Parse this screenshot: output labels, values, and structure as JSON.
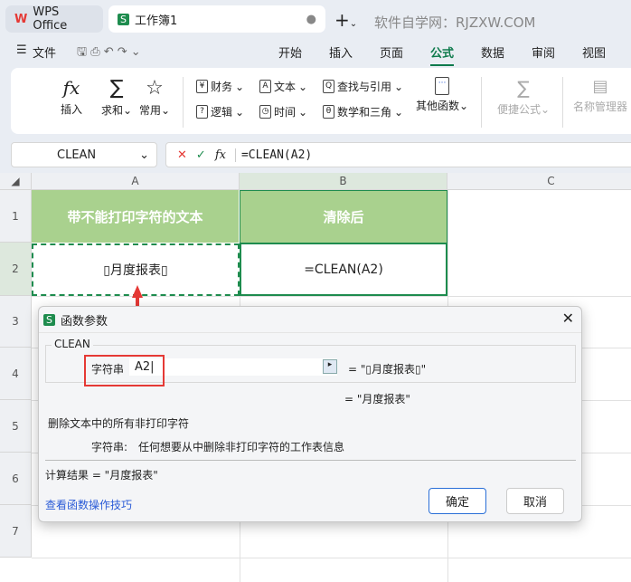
{
  "tabs": {
    "home": "WPS Office",
    "doc": "工作簿1",
    "watermark": "软件自学网：RJZXW.COM"
  },
  "menu": {
    "file": "文件",
    "items": [
      "开始",
      "插入",
      "页面",
      "公式",
      "数据",
      "审阅",
      "视图"
    ],
    "active": "公式",
    "accent": "#0e7a4c"
  },
  "ribbon": {
    "insert": "插入",
    "sum": "求和",
    "common": "常用",
    "finance": "财务",
    "text": "文本",
    "lookup": "查找与引用",
    "logic": "逻辑",
    "time": "时间",
    "math": "数学和三角",
    "other": "其他函数",
    "quick": "便捷公式",
    "names": "名称管理器"
  },
  "formula_bar": {
    "name_box": "CLEAN",
    "formula": "=CLEAN(A2)"
  },
  "columns": [
    "A",
    "B",
    "C"
  ],
  "rows": [
    "1",
    "2",
    "3",
    "4",
    "5",
    "6",
    "7"
  ],
  "cells": {
    "A1": "带不能打印字符的文本",
    "B1": "清除后",
    "A2": "▯月度报表▯",
    "B2": "=CLEAN(A2)"
  },
  "colors": {
    "header_fill": "#a9d18e",
    "header_text": "#ffffff",
    "selection": "#1e8c4e",
    "annotation": "#e53935"
  },
  "dialog": {
    "title": "函数参数",
    "function": "CLEAN",
    "arg_label": "字符串",
    "arg_value": "A2",
    "arg_result": "= \"▯月度报表▯\"",
    "result": "= \"月度报表\"",
    "description": "删除文本中的所有非打印字符",
    "arg_desc_label": "字符串:",
    "arg_desc": "任何想要从中删除非打印字符的工作表信息",
    "calc_result": "计算结果  =  \"月度报表\"",
    "help_link": "查看函数操作技巧",
    "ok": "确定",
    "cancel": "取消"
  }
}
